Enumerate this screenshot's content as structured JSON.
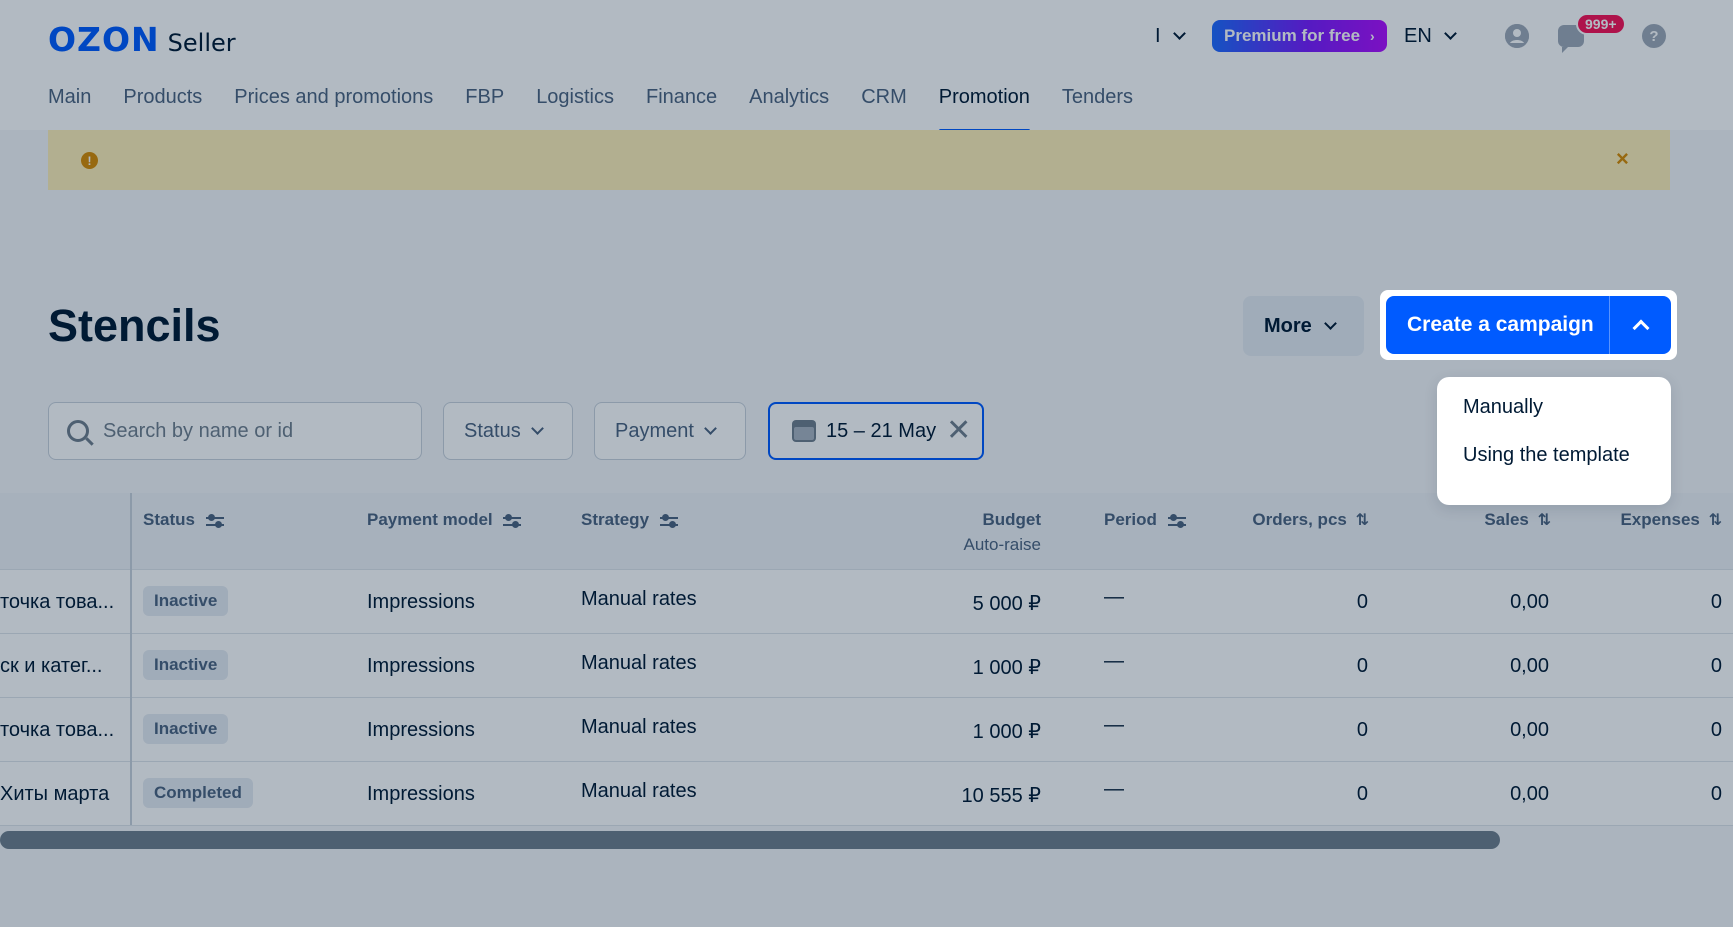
{
  "header": {
    "logo_brand": "OZON",
    "logo_product": "Seller",
    "account_selector": "I",
    "premium_label": "Premium for free",
    "premium_arrow": "›",
    "language": "EN",
    "chat_badge": "999+",
    "help_glyph": "?"
  },
  "nav": {
    "items": [
      "Main",
      "Products",
      "Prices and promotions",
      "FBP",
      "Logistics",
      "Finance",
      "Analytics",
      "CRM",
      "Promotion",
      "Tenders"
    ],
    "active": "Promotion"
  },
  "banner": {
    "warning_glyph": "!",
    "close_glyph": "×"
  },
  "page": {
    "title": "Stencils",
    "more_label": "More",
    "create_label": "Create a campaign"
  },
  "dropdown": {
    "items": [
      "Manually",
      "Using the template"
    ]
  },
  "filters": {
    "search_placeholder": "Search by name or id",
    "status_label": "Status",
    "payment_label": "Payment",
    "date_label": "15 – 21 May",
    "clear_glyph": "✕"
  },
  "table": {
    "headers": {
      "status": "Status",
      "payment_model": "Payment model",
      "strategy": "Strategy",
      "budget": "Budget",
      "budget_sub": "Auto-raise",
      "period": "Period",
      "orders": "Orders, pcs",
      "sales": "Sales",
      "expenses": "Expenses"
    },
    "sort_glyph": "⇅",
    "rows": [
      {
        "name": "точка това...",
        "status": "Inactive",
        "payment": "Impressions",
        "strategy": "Manual rates",
        "budget": "5 000 ₽",
        "period": "—",
        "orders": "0",
        "sales": "0,00",
        "expenses": "0"
      },
      {
        "name": "ск и катег...",
        "status": "Inactive",
        "payment": "Impressions",
        "strategy": "Manual rates",
        "budget": "1 000 ₽",
        "period": "—",
        "orders": "0",
        "sales": "0,00",
        "expenses": "0"
      },
      {
        "name": "точка това...",
        "status": "Inactive",
        "payment": "Impressions",
        "strategy": "Manual rates",
        "budget": "1 000 ₽",
        "period": "—",
        "orders": "0",
        "sales": "0,00",
        "expenses": "0"
      },
      {
        "name": "Хиты марта",
        "status": "Completed",
        "payment": "Impressions",
        "strategy": "Manual rates",
        "budget": "10 555 ₽",
        "period": "—",
        "orders": "0",
        "sales": "0,00",
        "expenses": "0"
      }
    ]
  },
  "colors": {
    "brand": "#005bff",
    "premium_gradient_start": "#1f6bff",
    "premium_gradient_end": "#b10dff",
    "badge": "#f91155",
    "banner": "#fff0b8",
    "overlay": "rgba(0,26,52,0.30)"
  },
  "icons": {
    "account": "user-circle-icon",
    "chat": "chat-bubble-icon",
    "help": "question-circle-icon",
    "search": "search-icon",
    "calendar": "calendar-icon",
    "filter": "filter-sliders-icon",
    "sort": "sort-arrows-icon"
  }
}
